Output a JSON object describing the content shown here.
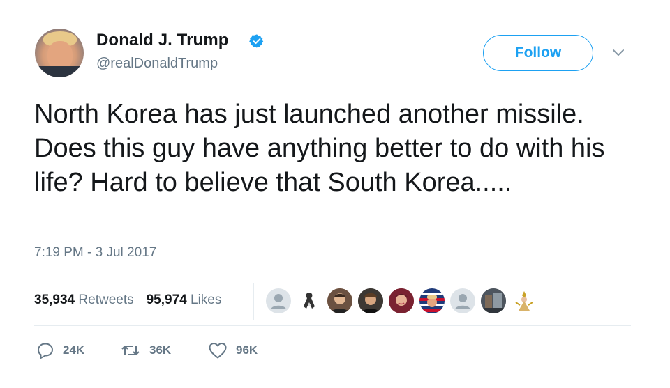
{
  "user": {
    "display_name": "Donald J. Trump",
    "handle": "@realDonaldTrump",
    "verified": true
  },
  "follow": {
    "label": "Follow"
  },
  "tweet": {
    "text": "North Korea has just launched another missile. Does this guy have anything better to do with his life? Hard to believe that South Korea.....",
    "timestamp": "7:19 PM - 3 Jul 2017"
  },
  "stats": {
    "retweets_count": "35,934",
    "retweets_label": "Retweets",
    "likes_count": "95,974",
    "likes_label": "Likes"
  },
  "actions": {
    "reply_count": "24K",
    "retweet_count": "36K",
    "like_count": "96K"
  },
  "colors": {
    "brand_blue": "#1da1f2",
    "secondary_text": "#657786",
    "divider": "#e6ecf0"
  },
  "icons": {
    "verified": "verified-badge-icon",
    "caret": "chevron-down-icon",
    "reply": "reply-icon",
    "retweet": "retweet-icon",
    "like": "heart-icon"
  }
}
